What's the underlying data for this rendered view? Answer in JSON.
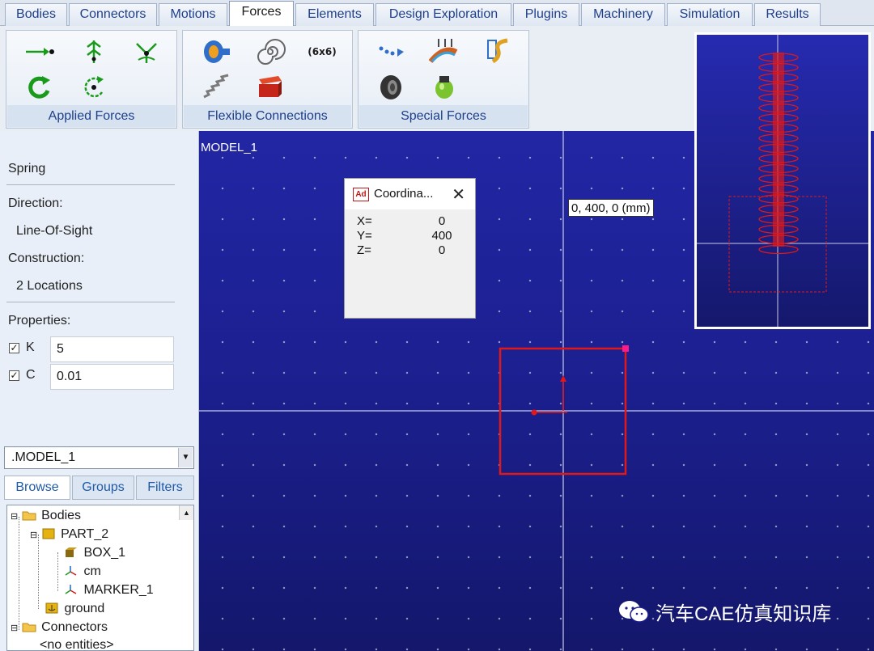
{
  "tabs": [
    "Bodies",
    "Connectors",
    "Motions",
    "Forces",
    "Elements",
    "Design Exploration",
    "Plugins",
    "Machinery",
    "Simulation",
    "Results"
  ],
  "ribbon": {
    "applied_forces_label": "Applied Forces",
    "flexible_connections_label": "Flexible Connections",
    "special_forces_label": "Special Forces",
    "matrix_icon_text": "(6x6)"
  },
  "panel": {
    "title": "Spring",
    "direction_label": "Direction:",
    "direction_value": "Line-Of-Sight",
    "construction_label": "Construction:",
    "construction_value": "2 Locations",
    "properties_label": "Properties:",
    "k_label": "K",
    "k_value": "5",
    "c_label": "C",
    "c_value": "0.01"
  },
  "browser": {
    "model_select": ".MODEL_1",
    "tabs": [
      "Browse",
      "Groups",
      "Filters"
    ],
    "tree": [
      "Bodies",
      "PART_2",
      "BOX_1",
      "cm",
      "MARKER_1",
      "ground",
      "Connectors",
      "<no entities>"
    ]
  },
  "viewport": {
    "model_label": "MODEL_1",
    "cursor_readout": "0, 400, 0 (mm)"
  },
  "coord_dialog": {
    "title": "Coordina...",
    "x_label": "X=",
    "x_value": "0",
    "y_label": "Y=",
    "y_value": "400",
    "z_label": "Z=",
    "z_value": "0"
  },
  "watermark": "汽车CAE仿真知识库",
  "colors": {
    "viewport_top": "#2226a4",
    "viewport_bottom": "#14176b",
    "geometry": "#e01818",
    "tab_text": "#1e3f8a"
  }
}
